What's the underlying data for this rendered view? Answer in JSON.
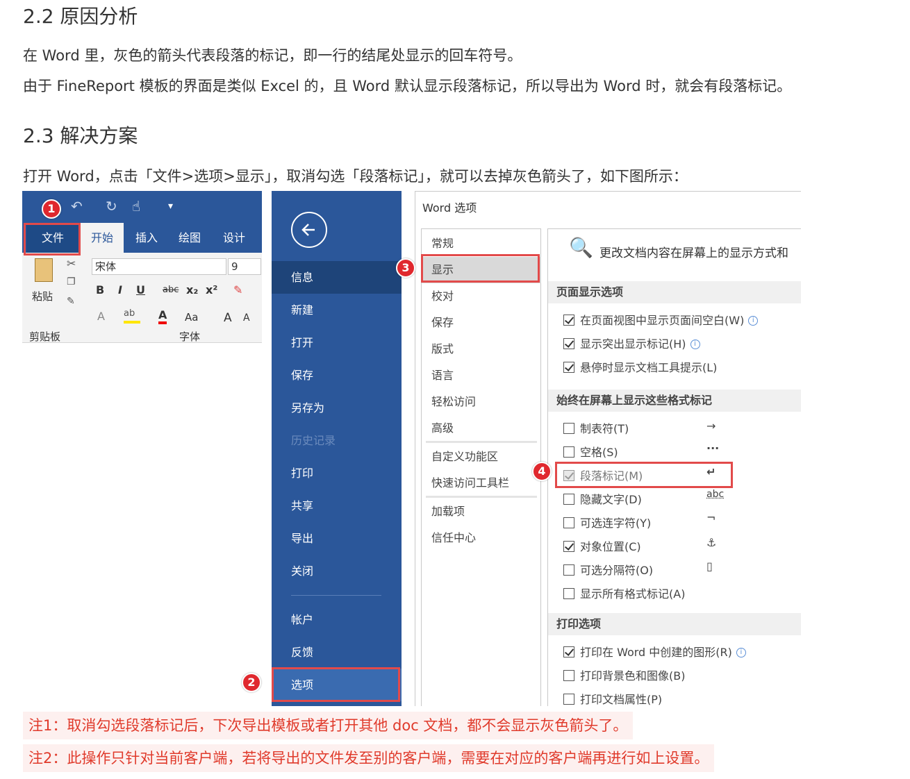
{
  "doc": {
    "h22": "2.2 原因分析",
    "p1": "在 Word 里，灰色的箭头代表段落的标记，即一行的结尾处显示的回车符号。",
    "p2": "由于 FineReport 模板的界面是类似 Excel 的，且 Word 默认显示段落标记，所以导出为 Word 时，就会有段落标记。",
    "h23": "2.3 解决方案",
    "p3": "打开 Word，点击「文件>选项>显示」，取消勾选「段落标记」，就可以去掉灰色箭头了，如下图所示：",
    "note1": "注1：取消勾选段落标记后，下次导出模板或者打开其他 doc 文档，都不会显示灰色箭头了。",
    "note2": "注2：此操作只针对当前客户端，若将导出的文件发至别的客户端，需要在对应的客户端再进行如上设置。"
  },
  "ribbon": {
    "tabs": [
      "文件",
      "开始",
      "插入",
      "绘图",
      "设计"
    ],
    "paste": "粘贴",
    "font_name": "宋体",
    "font_size": "9",
    "clipboard_group": "剪贴板",
    "font_group": "字体",
    "bold": "B",
    "italic": "I",
    "underline": "U",
    "strike": "abc",
    "sub": "x₂",
    "sup": "x²",
    "aa": "Aa",
    "grow": "A",
    "shrink": "A"
  },
  "backstage": {
    "items": [
      "信息",
      "新建",
      "打开",
      "保存",
      "另存为",
      "历史记录",
      "打印",
      "共享",
      "导出",
      "关闭",
      "帐户",
      "反馈",
      "选项"
    ]
  },
  "dialog": {
    "title": "Word 选项",
    "nav": [
      "常规",
      "显示",
      "校对",
      "保存",
      "版式",
      "语言",
      "轻松访问",
      "高级",
      "自定义功能区",
      "快速访问工具栏",
      "加载项",
      "信任中心"
    ],
    "header_text": "更改文档内容在屏幕上的显示方式和",
    "sec1": "页面显示选项",
    "opt1": "在页面视图中显示页面间空白(W)",
    "opt2": "显示突出显示标记(H)",
    "opt3": "悬停时显示文档工具提示(L)",
    "sec2": "始终在屏幕上显示这些格式标记",
    "marks": [
      {
        "label": "制表符(T)",
        "sym": "→"
      },
      {
        "label": "空格(S)",
        "sym": "···"
      },
      {
        "label": "段落标记(M)",
        "sym": "↵"
      },
      {
        "label": "隐藏文字(D)",
        "sym": "abc"
      },
      {
        "label": "可选连字符(Y)",
        "sym": "¬"
      },
      {
        "label": "对象位置(C)",
        "sym": "⚓"
      },
      {
        "label": "可选分隔符(O)",
        "sym": "▯"
      },
      {
        "label": "显示所有格式标记(A)",
        "sym": ""
      }
    ],
    "sec3": "打印选项",
    "p_opt1": "打印在 Word 中创建的图形(R)",
    "p_opt2": "打印背景色和图像(B)",
    "p_opt3": "打印文档属性(P)"
  },
  "badges": [
    "1",
    "2",
    "3",
    "4"
  ],
  "colors": {
    "word_blue": "#2b579a",
    "callout_red": "#e24a4a",
    "note_red": "#e03a2b"
  }
}
